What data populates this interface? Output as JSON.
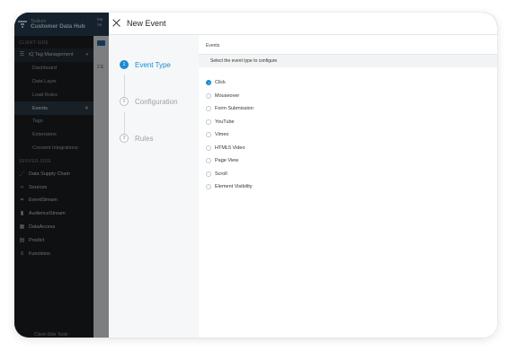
{
  "sidebar": {
    "brand_sub": "Tealium",
    "brand_name": "Customer Data Hub",
    "client_section": "CLIENT-SIDE",
    "tag_management": "iQ Tag Management",
    "sub_items": [
      "Dashboard",
      "Data Layer",
      "Load Rules",
      "Events",
      "Tags",
      "Extensions",
      "Consent Integrations"
    ],
    "active_sub": "Events",
    "server_section": "SERVER-SIDE",
    "server_items": [
      {
        "label": "Data Supply Chain",
        "icon": "supply-chain-icon"
      },
      {
        "label": "Sources",
        "icon": "code-icon"
      },
      {
        "label": "EventStream",
        "icon": "eventstream-icon"
      },
      {
        "label": "AudienceStream",
        "icon": "audiencestream-icon"
      },
      {
        "label": "DataAccess",
        "icon": "dataaccess-icon"
      },
      {
        "label": "Predict",
        "icon": "predict-icon"
      },
      {
        "label": "Functions",
        "icon": "functions-icon"
      }
    ],
    "footer": "Client-Side Tools"
  },
  "background": {
    "header_text_1": "Ma",
    "header_text_2": "Ve",
    "row_text": "2 E"
  },
  "modal": {
    "title": "New Event",
    "steps": [
      {
        "num": "1",
        "label": "Event Type"
      },
      {
        "num": "2",
        "label": "Configuration"
      },
      {
        "num": "3",
        "label": "Rules"
      }
    ],
    "panel_label": "Events",
    "instruction": "Select the event type to configure",
    "options": [
      "Click",
      "Mouseover",
      "Form Submission",
      "YouTube",
      "Vimeo",
      "HTML5 Video",
      "Page View",
      "Scroll",
      "Element Visibility"
    ],
    "selected": "Click"
  },
  "colors": {
    "accent": "#1b8bd6",
    "sidebar_bg": "#1b1f24",
    "header_bg": "#2a4256",
    "star": "#e8a33c"
  }
}
